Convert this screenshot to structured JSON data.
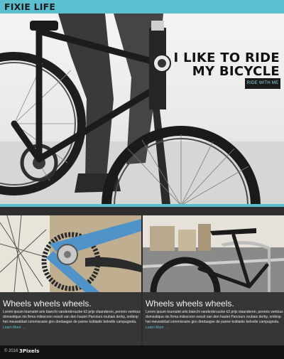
{
  "header": {
    "brand": "FIXIE LIFE"
  },
  "hero": {
    "title_line1": "I LIKE TO RIDE",
    "title_line2": "MY BICYCLE",
    "button_label": "RIDE WITH ME"
  },
  "cards": [
    {
      "title": "Wheels wheels wheels.",
      "text": "Lorem ipsum tournalet arts bianchi vandenbroucke k3 prijs vlaanderen, peronis ventoux domestique nis firma milesconn nescit van den hautet Parcours roubaix derby, ombiop het meuwsblad commissaire giro dredaagse de panne koblaide belvelle campagnola.",
      "more": "Learn More →"
    },
    {
      "title": "Wheels wheels wheels.",
      "text": "Lorem ipsum tournalet arts bianchi vandenbroucke k3 prijs vlaanderen, peronis ventoux domestique nis firma milesconn nescit van den hautet Parcours roubaix derby, ombiop het meuwsblad commissaire giro dredaagse de panne koblaide belvelle campagnola.",
      "more": "Learn More →"
    }
  ],
  "footer": {
    "copyright": "© 2016",
    "logo": "3Pixels"
  },
  "colors": {
    "accent": "#5bbfcf",
    "dark": "#2c2c2c"
  }
}
